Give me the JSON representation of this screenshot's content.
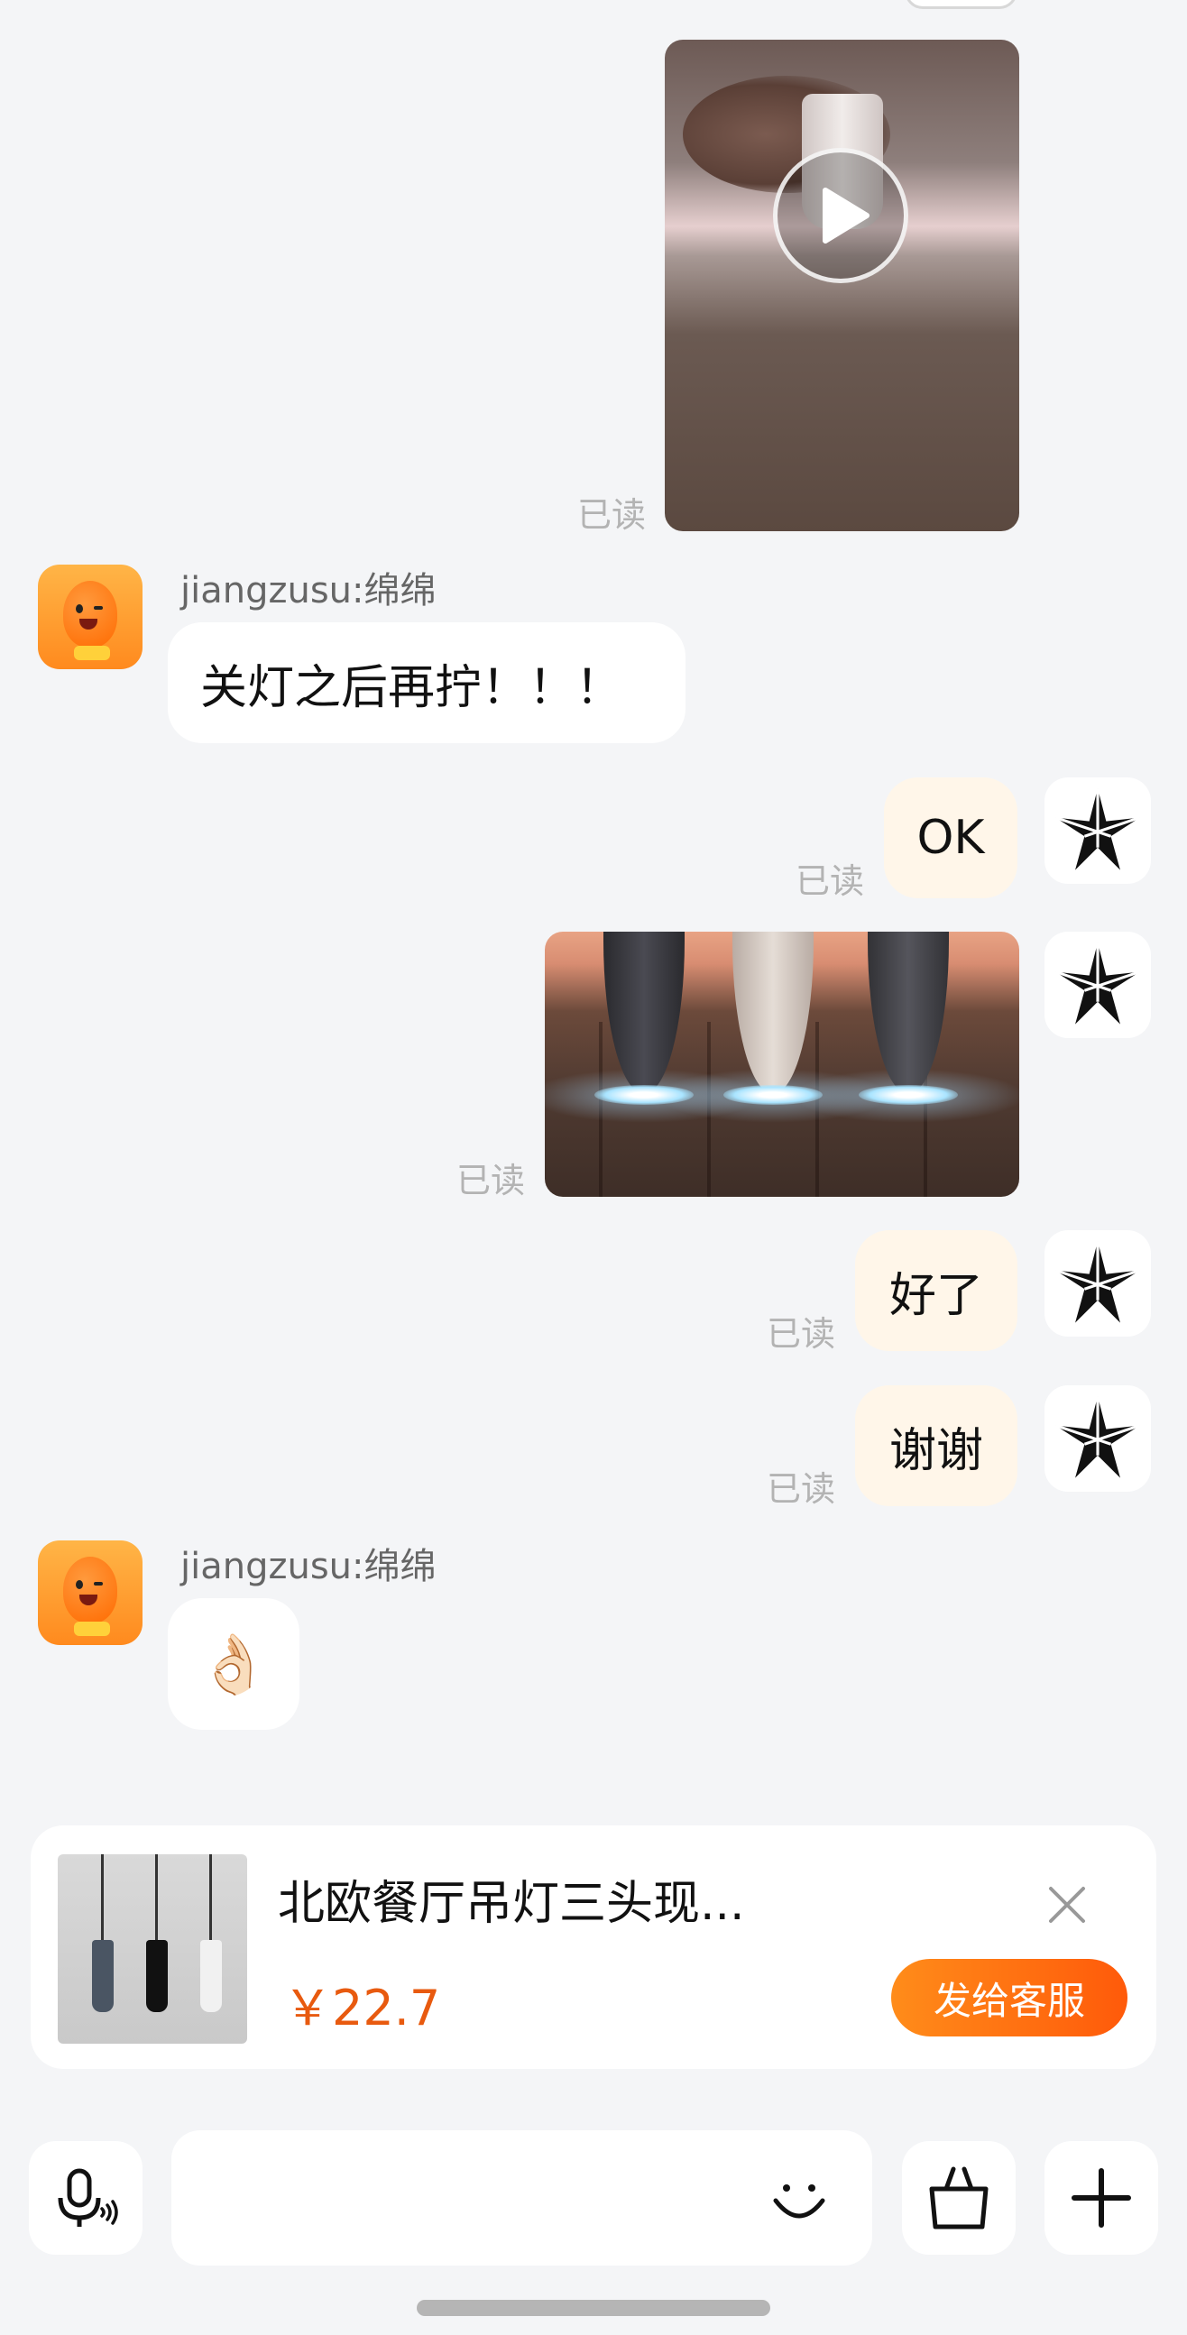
{
  "messages": {
    "video": {
      "read_status": "已读"
    },
    "msg1": {
      "sender": "jiangzusu:绵绵",
      "text": "关灯之后再拧！！！"
    },
    "msg2": {
      "text": "OK",
      "read_status": "已读"
    },
    "msg3": {
      "read_status": "已读"
    },
    "msg4": {
      "text": "好了",
      "read_status": "已读"
    },
    "msg5": {
      "text": "谢谢",
      "read_status": "已读"
    },
    "msg6": {
      "sender": "jiangzusu:绵绵",
      "text": "👌🏻"
    }
  },
  "product_card": {
    "title": "北欧餐厅吊灯三头现...",
    "price": "￥22.7",
    "send_label": "发给客服"
  },
  "colors": {
    "accent": "#ff6a00",
    "price": "#e85a0f",
    "my_bubble": "#fff6e9",
    "background": "#f4f5f7"
  },
  "icons": [
    "play-icon",
    "star-logo-icon",
    "close-icon",
    "voice-icon",
    "emoji-icon",
    "shopping-bag-icon",
    "plus-icon"
  ]
}
